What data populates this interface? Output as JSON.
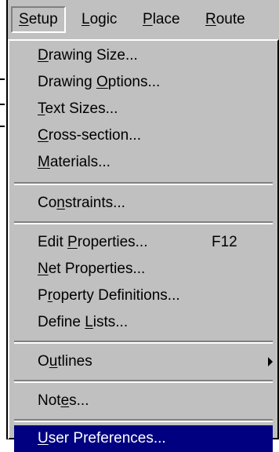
{
  "menubar": {
    "items": [
      {
        "mnemonic": "S",
        "rest": "etup"
      },
      {
        "mnemonic": "L",
        "rest": "ogic"
      },
      {
        "mnemonic": "P",
        "rest": "lace"
      },
      {
        "mnemonic": "R",
        "rest": "oute"
      }
    ]
  },
  "menu": {
    "drawing_size": {
      "before": "",
      "mnemonic": "D",
      "after": "rawing Size..."
    },
    "drawing_options": {
      "before": "Drawing ",
      "mnemonic": "O",
      "after": "ptions..."
    },
    "text_sizes": {
      "before": "",
      "mnemonic": "T",
      "after": "ext Sizes..."
    },
    "cross_section": {
      "before": "",
      "mnemonic": "C",
      "after": "ross-section..."
    },
    "materials": {
      "before": "",
      "mnemonic": "M",
      "after": "aterials..."
    },
    "constraints": {
      "before": "Co",
      "mnemonic": "n",
      "after": "straints..."
    },
    "edit_properties": {
      "before": "Edit ",
      "mnemonic": "P",
      "after": "roperties...",
      "shortcut": "F12"
    },
    "net_properties": {
      "before": "",
      "mnemonic": "N",
      "after": "et Properties..."
    },
    "property_definitions": {
      "before": "P",
      "mnemonic": "r",
      "after": "operty Definitions..."
    },
    "define_lists": {
      "before": "Define ",
      "mnemonic": "L",
      "after": "ists..."
    },
    "outlines": {
      "before": "O",
      "mnemonic": "u",
      "after": "tlines"
    },
    "notes": {
      "before": "Not",
      "mnemonic": "e",
      "after": "s..."
    },
    "user_preferences": {
      "before": "",
      "mnemonic": "U",
      "after": "ser Preferences..."
    }
  },
  "colors": {
    "menu_face": "#c0c0c0",
    "highlight": "#000080",
    "highlight_text": "#ffffff"
  }
}
